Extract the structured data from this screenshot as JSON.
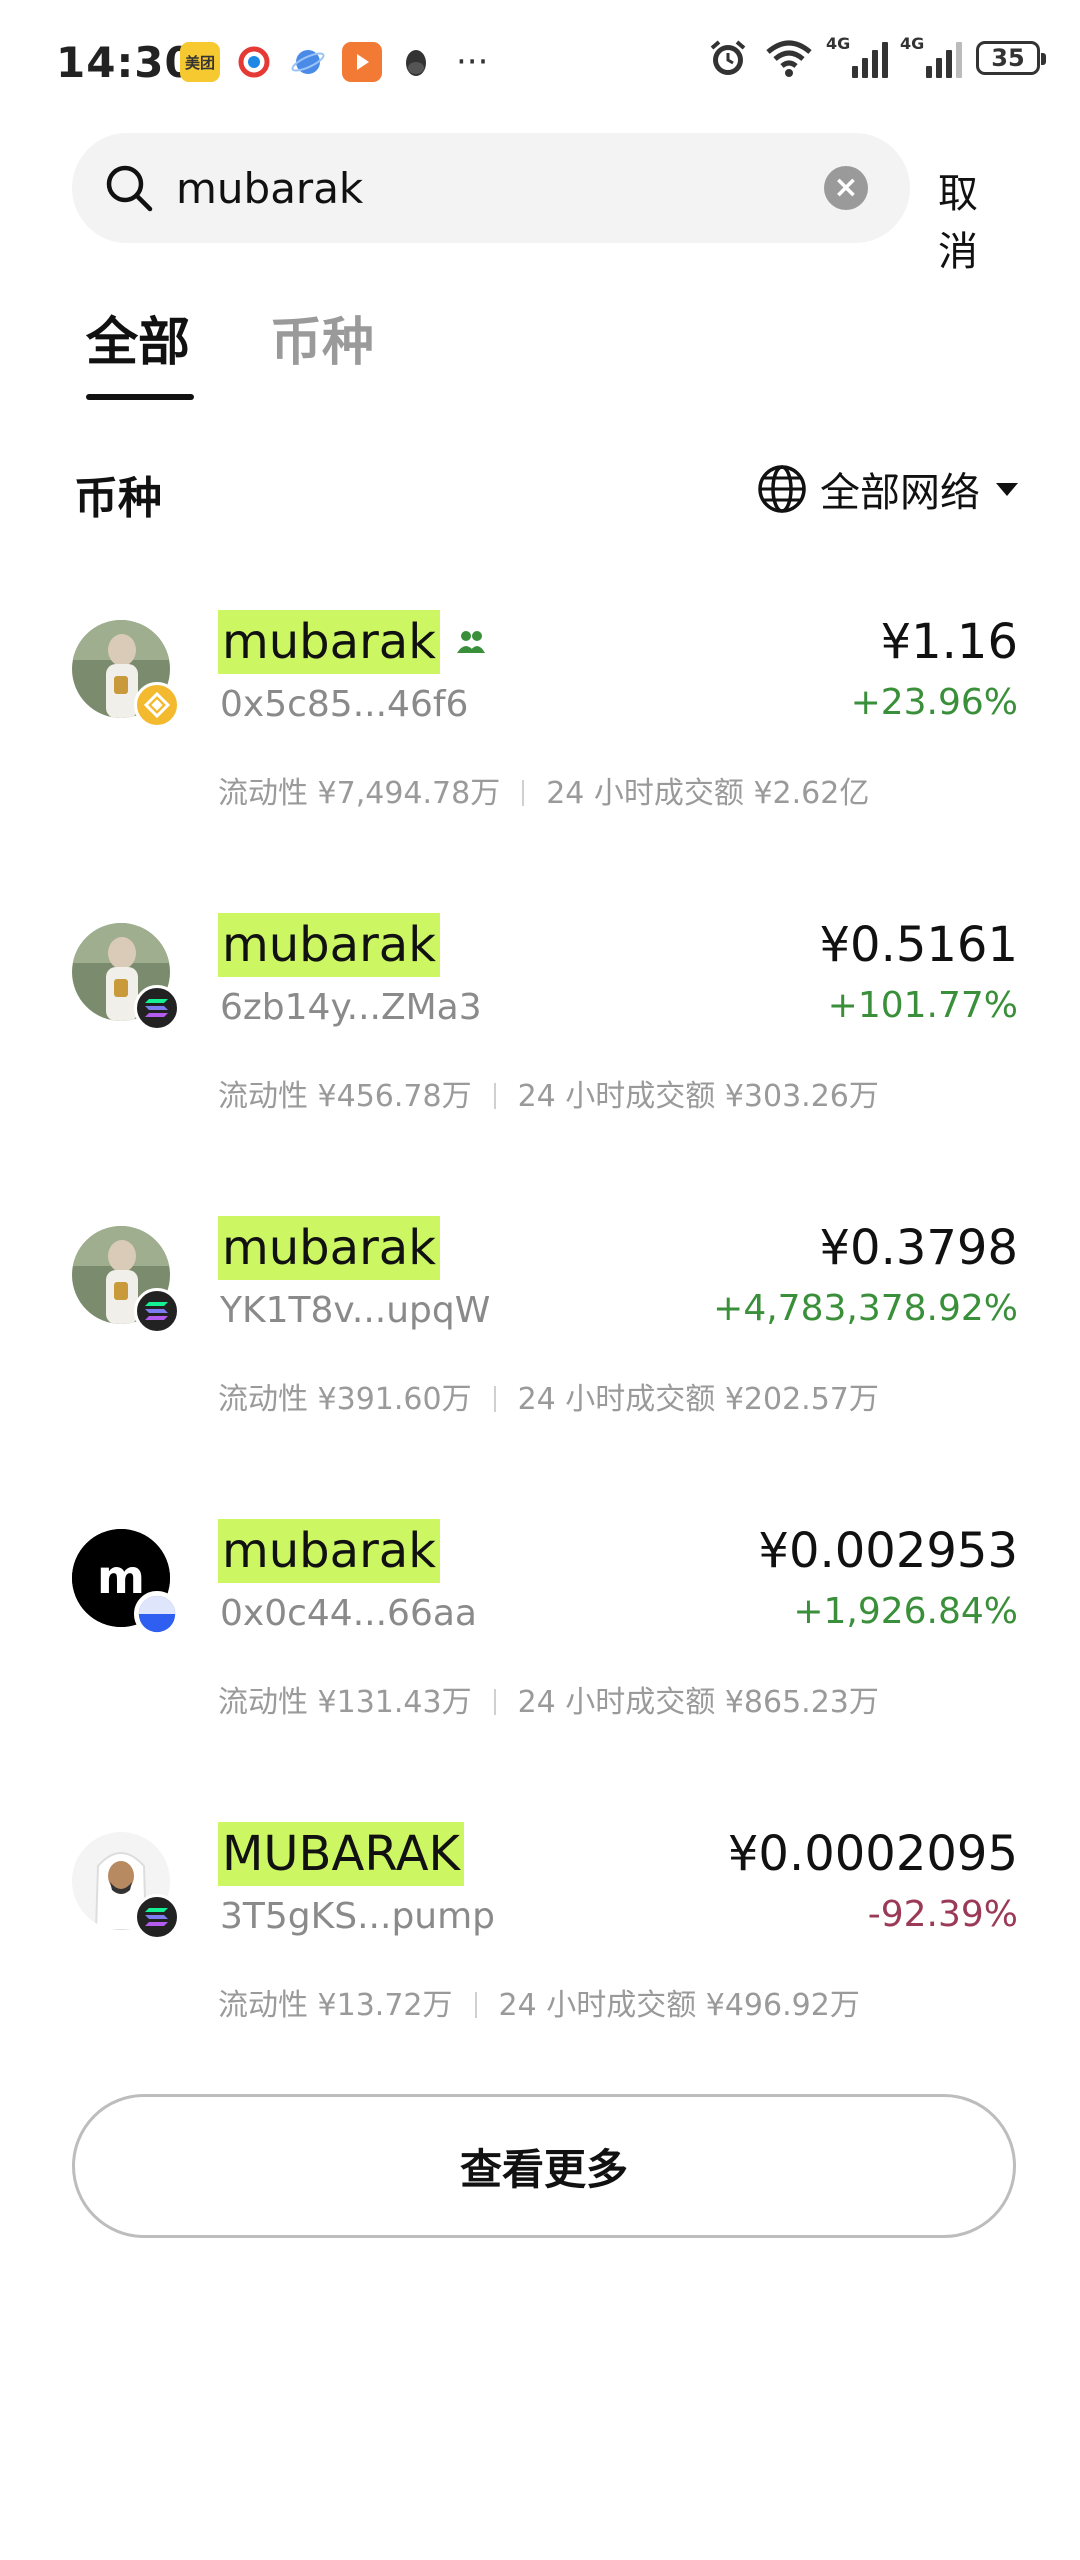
{
  "status_bar": {
    "time": "14:30",
    "app_badge": "美团",
    "signal1_label": "4G",
    "signal2_label": "4G",
    "battery": "35"
  },
  "search": {
    "value": "mubarak",
    "placeholder": "",
    "cancel_label": "取消"
  },
  "tabs": [
    {
      "label": "全部",
      "active": true
    },
    {
      "label": "币种",
      "active": false
    }
  ],
  "section": {
    "title": "币种",
    "network_filter": "全部网络"
  },
  "tokens": [
    {
      "name": "mubarak",
      "address": "0x5c85...46f6",
      "price": "¥1.16",
      "change": "+23.96%",
      "liquidity": "流动性 ¥7,494.78万",
      "volume": "24 小时成交额 ¥2.62亿",
      "chain_icon": "bnb-chain-icon",
      "has_community": true
    },
    {
      "name": "mubarak",
      "address": "6zb14y...ZMa3",
      "price": "¥0.5161",
      "change": "+101.77%",
      "liquidity": "流动性 ¥456.78万",
      "volume": "24 小时成交额 ¥303.26万",
      "chain_icon": "solana-chain-icon",
      "has_community": false
    },
    {
      "name": "mubarak",
      "address": "YK1T8v...upqW",
      "price": "¥0.3798",
      "change": "+4,783,378.92%",
      "liquidity": "流动性 ¥391.60万",
      "volume": "24 小时成交额 ¥202.57万",
      "chain_icon": "solana-chain-icon",
      "has_community": false
    },
    {
      "name": "mubarak",
      "address": "0x0c44...66aa",
      "price": "¥0.002953",
      "change": "+1,926.84%",
      "liquidity": "流动性 ¥131.43万",
      "volume": "24 小时成交额 ¥865.23万",
      "chain_icon": "base-chain-icon",
      "has_community": false
    },
    {
      "name": "MUBARAK",
      "address": "3T5gKS...pump",
      "price": "¥0.0002095",
      "change": "-92.39%",
      "liquidity": "流动性 ¥13.72万",
      "volume": "24 小时成交额 ¥496.92万",
      "chain_icon": "solana-chain-icon",
      "has_community": false
    }
  ],
  "more_button": "查看更多",
  "colors": {
    "highlight": "#ccf763",
    "up": "#3a8f3a",
    "down": "#9b3a57"
  }
}
